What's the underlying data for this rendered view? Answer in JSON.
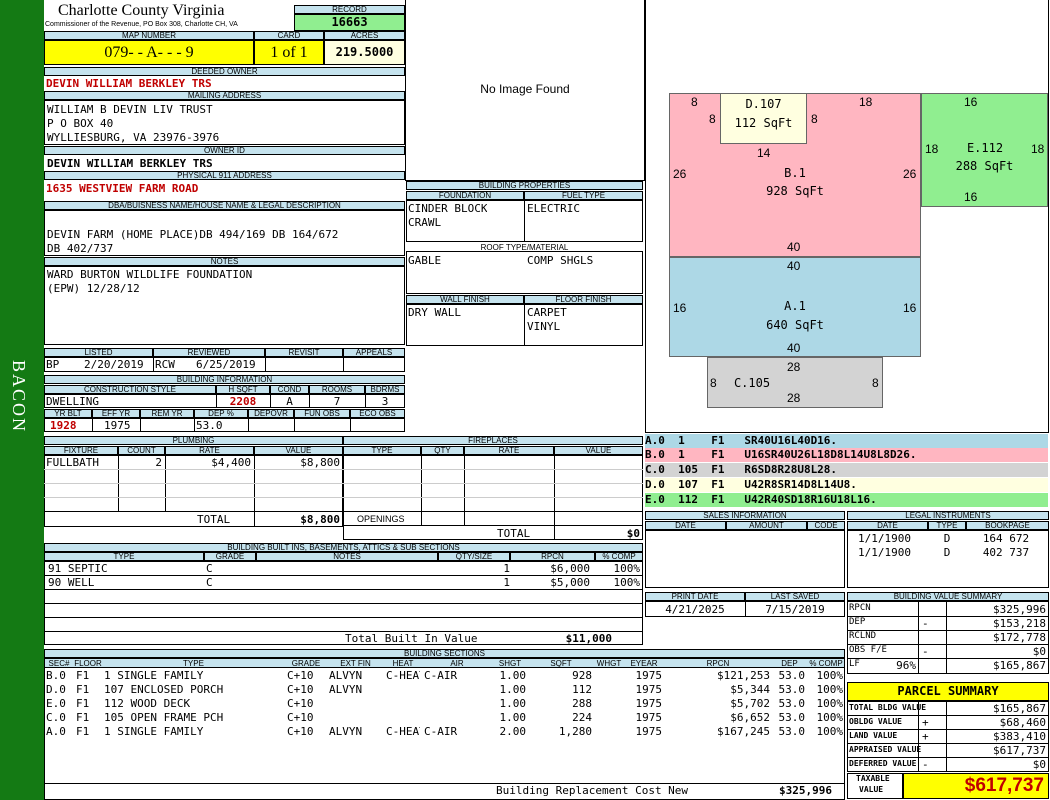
{
  "sidebar": {
    "label": "BACON"
  },
  "header": {
    "county": "Charlotte County Virginia",
    "commissioner": "Commissioner of the Revenue, PO Box 308, Charlotte CH, VA",
    "record_label": "RECORD",
    "record": "16663",
    "map_label": "MAP NUMBER",
    "map": "079- - A- - - 9",
    "card_label": "CARD",
    "card": "1 of 1",
    "acres_label": "ACRES",
    "acres": "219.5000"
  },
  "owner": {
    "deeded_label": "DEEDED OWNER",
    "deeded": "DEVIN WILLIAM BERKLEY TRS",
    "mailing_label": "MAILING ADDRESS",
    "mail1": "WILLIAM B DEVIN LIV TRUST",
    "mail2": "P O BOX 40",
    "mail3": "WYLLIESBURG, VA 23976-3976",
    "ownerid_label": "OWNER ID",
    "ownerid": "DEVIN WILLIAM BERKLEY TRS",
    "phys_label": "PHYSICAL 911 ADDRESS",
    "phys": "1635 WESTVIEW FARM ROAD",
    "dba_label": "DBA/BUISNESS NAME/HOUSE NAME & LEGAL DESCRIPTION",
    "dba1": "DEVIN FARM (HOME PLACE)DB 494/169 DB 164/672",
    "dba2": "DB 402/737",
    "notes_label": "NOTES",
    "notes1": "WARD BURTON WILDLIFE FOUNDATION",
    "notes2": "(EPW) 12/28/12"
  },
  "listing": {
    "listed_label": "LISTED",
    "reviewed_label": "REVIEWED",
    "revisit_label": "REVISIT",
    "appeals_label": "APPEALS",
    "listed_by": "BP",
    "listed_date": "2/20/2019",
    "reviewed_by": "RCW",
    "reviewed_date": "6/25/2019"
  },
  "building_info": {
    "title": "BUILDING INFORMATION",
    "h_cs": "CONSTRUCTION STYLE",
    "h_sqft": "H SQFT",
    "h_cond": "COND",
    "h_rooms": "ROOMS",
    "h_bdrms": "BDRMS",
    "cs": "DWELLING",
    "sqft": "2208",
    "cond": "A",
    "rooms": "7",
    "bdrms": "3",
    "h_yrblt": "YR BLT",
    "h_effyr": "EFF YR",
    "h_remyr": "REM YR",
    "h_dep": "DEP %",
    "h_depovr": "DEPOVR",
    "h_funobs": "FUN OBS",
    "h_ecoobs": "ECO OBS",
    "yrblt": "1928",
    "effyr": "1975",
    "dep": "53.0"
  },
  "photo": {
    "text": "No Image Found"
  },
  "bprops": {
    "title": "BUILDING PROPERTIES",
    "h_found": "FOUNDATION",
    "h_fuel": "FUEL TYPE",
    "found1": "CINDER BLOCK",
    "found2": "CRAWL",
    "fuel": "ELECTRIC",
    "h_roof": "ROOF TYPE/MATERIAL",
    "roof1": "GABLE",
    "roof2": "COMP SHGLS",
    "h_wall": "WALL FINISH",
    "h_floor": "FLOOR FINISH",
    "wall": "DRY WALL",
    "floor1": "CARPET",
    "floor2": "VINYL"
  },
  "sketch": {
    "d_label": "D.107",
    "d_sqft": "112 SqFt",
    "b_label": "B.1",
    "b_sqft": "928 SqFt",
    "e_label": "E.112",
    "e_sqft": "288 SqFt",
    "a_label": "A.1",
    "a_sqft": "640 SqFt",
    "c_label": "C.105",
    "n8a": "8",
    "n8b": "8",
    "n8c": "8",
    "n18a": "18",
    "n16a": "16",
    "n14": "14",
    "n26a": "26",
    "n26b": "26",
    "n18b": "18",
    "n18c": "18",
    "n16b": "16",
    "n40a": "40",
    "n40b": "40",
    "n16c": "16",
    "n16d": "16",
    "n40c": "40",
    "n28a": "28",
    "n28b": "28",
    "n8d": "8",
    "n8e": "8"
  },
  "areas": [
    {
      "text": "A.0  1    F1   SR40U16L40D16.",
      "color": "#add8e6"
    },
    {
      "text": "B.0  1    F1   U16SR40U26L18D8L14U8L8D26.",
      "color": "#ffb6c1"
    },
    {
      "text": "C.0  105  F1   R6SD8R28U8L28.",
      "color": "#d3d3d3"
    },
    {
      "text": "D.0  107  F1   U42R8SR14D8L14U8.",
      "color": "#ffffe0"
    },
    {
      "text": "E.0  112  F1   U42R40SD18R16U18L16.",
      "color": "#90ee90"
    }
  ],
  "plumbing": {
    "title": "PLUMBING",
    "h_fixture": "FIXTURE",
    "h_count": "COUNT",
    "h_rate": "RATE",
    "h_value": "VALUE",
    "fixture": "FULLBATH",
    "count": "2",
    "rate": "$4,400",
    "value": "$8,800",
    "total_label": "TOTAL",
    "total": "$8,800"
  },
  "fireplaces": {
    "title": "FIREPLACES",
    "h_type": "TYPE",
    "h_qty": "QTY",
    "h_rate": "RATE",
    "h_value": "VALUE",
    "openings_label": "OPENINGS",
    "total_label": "TOTAL",
    "total": "$0"
  },
  "sales": {
    "title": "SALES INFORMATION",
    "h_date": "DATE",
    "h_amount": "AMOUNT",
    "h_code": "CODE"
  },
  "legal": {
    "title": "LEGAL INSTRUMENTS",
    "h_date": "DATE",
    "h_type": "TYPE",
    "h_book": "BOOKPAGE",
    "rows": [
      {
        "date": "1/1/1900",
        "type": "D",
        "book": "164 672"
      },
      {
        "date": "1/1/1900",
        "type": "D",
        "book": "402 737"
      }
    ]
  },
  "builtins": {
    "title": "BUILDING BUILT INS, BASEMENTS, ATTICS & SUB SECTIONS",
    "h_type": "TYPE",
    "h_grade": "GRADE",
    "h_notes": "NOTES",
    "h_qty": "QTY/SIZE",
    "h_rpcn": "RPCN",
    "h_comp": "% COMP",
    "rows": [
      {
        "type": "91 SEPTIC",
        "grade": "C",
        "qty": "1",
        "rpcn": "$6,000",
        "comp": "100%"
      },
      {
        "type": "90 WELL",
        "grade": "C",
        "qty": "1",
        "rpcn": "$5,000",
        "comp": "100%"
      }
    ],
    "total_label": "Total Built In Value",
    "total": "$11,000"
  },
  "print": {
    "h_print": "PRINT DATE",
    "h_saved": "LAST SAVED",
    "print": "4/21/2025",
    "saved": "7/15/2019"
  },
  "bvs": {
    "title": "BUILDING VALUE SUMMARY",
    "rows": [
      {
        "label": "RPCN",
        "sign": "",
        "value": "$325,996"
      },
      {
        "label": "DEP",
        "sign": "-",
        "value": "$153,218"
      },
      {
        "label": "RCLND",
        "sign": "",
        "value": "$172,778"
      },
      {
        "label": "OBS F/E",
        "sign": "-",
        "value": "$0"
      },
      {
        "label": "LF",
        "sign": "96%",
        "value": "$165,867"
      }
    ]
  },
  "sections": {
    "title": "BUILDING SECTIONS",
    "headers": [
      "SEC#",
      "FLOOR",
      "TYPE",
      "GRADE",
      "EXT FIN",
      "HEAT",
      "AIR",
      "SHGT",
      "SQFT",
      "WHGT",
      "EYEAR",
      "RPCN",
      "DEP",
      "% COMP"
    ],
    "rows": [
      {
        "sec": "B.0",
        "floor": "F1",
        "type": "1 SINGLE FAMILY",
        "grade": "C+10",
        "ext": "ALVYN",
        "heat": "C-HEAT",
        "air": "C-AIR",
        "shgt": "1.00",
        "sqft": "928",
        "eyear": "1975",
        "rpcn": "$121,253",
        "dep": "53.0",
        "comp": "100%"
      },
      {
        "sec": "D.0",
        "floor": "F1",
        "type": "107 ENCLOSED PORCH",
        "grade": "C+10",
        "ext": "ALVYN",
        "heat": "",
        "air": "",
        "shgt": "1.00",
        "sqft": "112",
        "eyear": "1975",
        "rpcn": "$5,344",
        "dep": "53.0",
        "comp": "100%"
      },
      {
        "sec": "E.0",
        "floor": "F1",
        "type": "112 WOOD DECK",
        "grade": "C+10",
        "ext": "",
        "heat": "",
        "air": "",
        "shgt": "1.00",
        "sqft": "288",
        "eyear": "1975",
        "rpcn": "$5,702",
        "dep": "53.0",
        "comp": "100%"
      },
      {
        "sec": "C.0",
        "floor": "F1",
        "type": "105 OPEN FRAME PCH",
        "grade": "C+10",
        "ext": "",
        "heat": "",
        "air": "",
        "shgt": "1.00",
        "sqft": "224",
        "eyear": "1975",
        "rpcn": "$6,652",
        "dep": "53.0",
        "comp": "100%"
      },
      {
        "sec": "A.0",
        "floor": "F1",
        "type": "1 SINGLE FAMILY",
        "grade": "C+10",
        "ext": "ALVYN",
        "heat": "C-HEAT",
        "air": "C-AIR",
        "shgt": "2.00",
        "sqft": "1,280",
        "eyear": "1975",
        "rpcn": "$167,245",
        "dep": "53.0",
        "comp": "100%"
      }
    ],
    "replacement_label": "Building Replacement Cost New",
    "replacement": "$325,996"
  },
  "parcel": {
    "title": "PARCEL SUMMARY",
    "rows": [
      {
        "label": "TOTAL BLDG VALUE",
        "sign": "",
        "value": "$165,867"
      },
      {
        "label": "OBLDG VALUE",
        "sign": "+",
        "value": "$68,460"
      },
      {
        "label": "LAND VALUE",
        "sign": "+",
        "value": "$383,410"
      },
      {
        "label": "APPRAISED VALUE",
        "sign": "",
        "value": "$617,737"
      },
      {
        "label": "DEFERRED VALUE",
        "sign": "-",
        "value": "$0"
      }
    ],
    "taxable_label1": "TAXABLE",
    "taxable_label2": "VALUE",
    "taxable": "$617,737"
  },
  "colors": {
    "sidebar": "#147a14",
    "header_bg": "#c5e3ee",
    "yellow": "#ffff00",
    "green": "#90ee90",
    "red": "#c00000"
  }
}
